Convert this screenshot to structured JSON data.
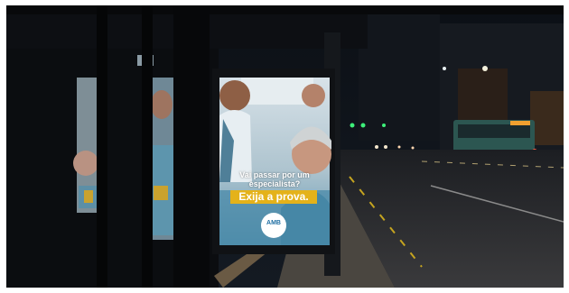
{
  "ad": {
    "question": "Vai passar por um especialista?",
    "cta": "Exija a prova.",
    "logo": "AMB",
    "colors": {
      "accent": "#e4b21a",
      "brand": "#1f6fa3"
    }
  }
}
